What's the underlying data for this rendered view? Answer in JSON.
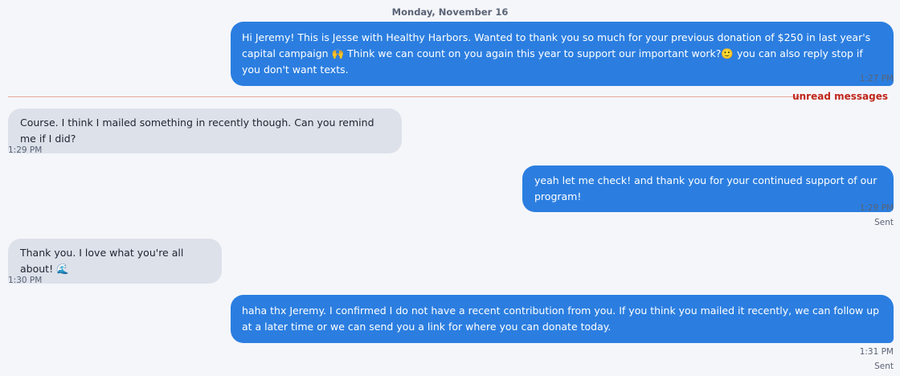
{
  "conversation": {
    "date_header": "Monday, November 16",
    "unread_label": "unread messages",
    "messages": [
      {
        "direction": "outgoing",
        "text_part1": "Hi Jeremy! This is Jesse with Healthy Harbors. Wanted to thank you so much for your previous donation of $250 in last year's capital campaign",
        "emoji1": "🙌",
        "text_part2": " Think we can count on you again this year to support our important work?",
        "emoji2": "🙂",
        "text_part3": " you can also reply stop if you don't want texts.",
        "time": "1:27 PM"
      },
      {
        "direction": "incoming",
        "text": "Course. I think I mailed something in recently though. Can you remind me if I did?",
        "time": "1:29 PM"
      },
      {
        "direction": "outgoing",
        "text": "yeah let me check! and thank you for your continued support of our program!",
        "time": "1:29 PM",
        "status": "Sent"
      },
      {
        "direction": "incoming",
        "text": "Thank you. I love what you're all about!",
        "emoji": "🌊",
        "time": "1:30 PM"
      },
      {
        "direction": "outgoing",
        "text": "haha thx Jeremy. I confirmed I do not have a recent contribution from you. If you think you mailed it recently, we can follow up at a later time or we can send you a link for where you can donate today.",
        "time": "1:31 PM",
        "status": "Sent"
      }
    ]
  },
  "colors": {
    "outgoing_bubble": "#2b7ee0",
    "incoming_bubble": "#dde1ea",
    "unread_label": "#c0261a",
    "background": "#f5f6fa"
  }
}
